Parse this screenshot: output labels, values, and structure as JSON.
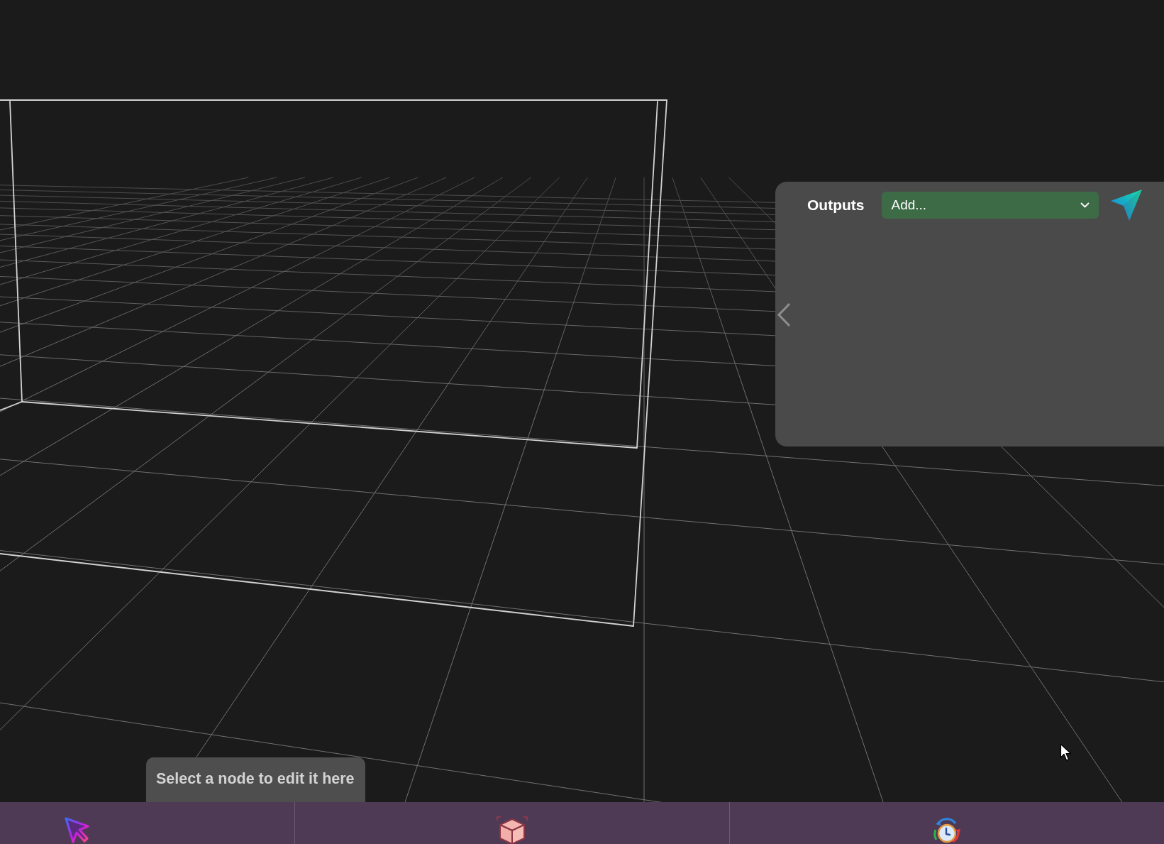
{
  "outputs_panel": {
    "title": "Outputs",
    "add_select": {
      "value": "Add..."
    }
  },
  "hint": "Select a node to edit it here"
}
